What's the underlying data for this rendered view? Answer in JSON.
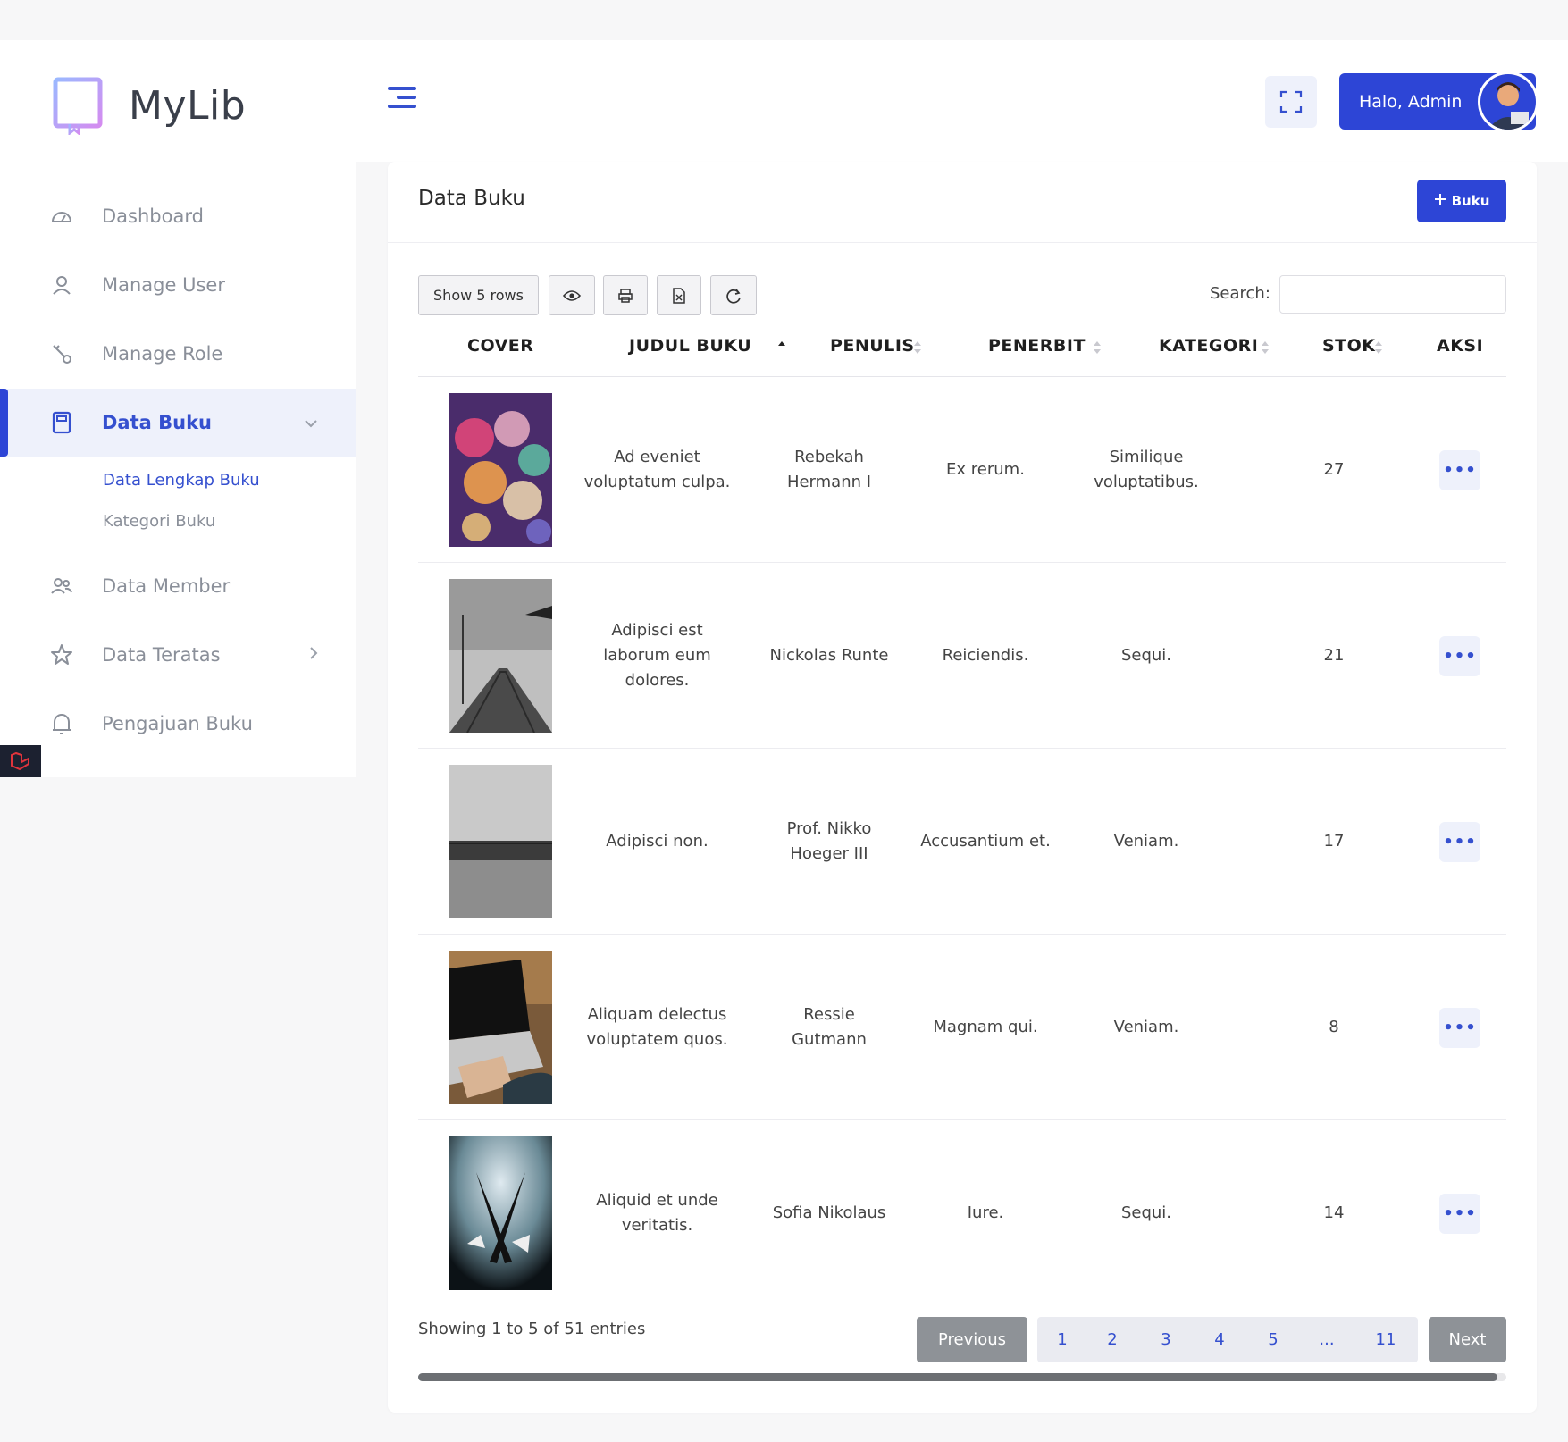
{
  "brand": {
    "name": "MyLib"
  },
  "sidebar": {
    "items": [
      {
        "label": "Dashboard",
        "icon": "dashboard-icon"
      },
      {
        "label": "Manage User",
        "icon": "user-icon"
      },
      {
        "label": "Manage Role",
        "icon": "key-icon"
      },
      {
        "label": "Data Buku",
        "icon": "book-icon",
        "active": true
      },
      {
        "label": "Data Member",
        "icon": "users-icon"
      },
      {
        "label": "Data Teratas",
        "icon": "star-icon"
      },
      {
        "label": "Pengajuan Buku",
        "icon": "bell-icon"
      }
    ],
    "subitems": [
      {
        "label": "Data Lengkap Buku",
        "active": true
      },
      {
        "label": "Kategori Buku",
        "active": false
      }
    ]
  },
  "topbar": {
    "user_label": "Halo, Admin"
  },
  "card": {
    "title": "Data Buku",
    "add_label": "Buku",
    "show_rows_label": "Show 5 rows",
    "search_label": "Search:",
    "search_value": ""
  },
  "table": {
    "headers": [
      "COVER",
      "JUDUL BUKU",
      "PENULIS",
      "PENERBIT",
      "KATEGORI",
      "STOK",
      "AKSI"
    ],
    "rows": [
      {
        "judul": "Ad eveniet voluptatum culpa.",
        "penulis": "Rebekah Hermann I",
        "penerbit": "Ex rerum.",
        "kategori": "Similique voluptatibus.",
        "stok": "27"
      },
      {
        "judul": "Adipisci est laborum eum dolores.",
        "penulis": "Nickolas Runte",
        "penerbit": "Reiciendis.",
        "kategori": "Sequi.",
        "stok": "21"
      },
      {
        "judul": "Adipisci non.",
        "penulis": "Prof. Nikko Hoeger III",
        "penerbit": "Accusantium et.",
        "kategori": "Veniam.",
        "stok": "17"
      },
      {
        "judul": "Aliquam delectus voluptatem quos.",
        "penulis": "Ressie Gutmann",
        "penerbit": "Magnam qui.",
        "kategori": "Veniam.",
        "stok": "8"
      },
      {
        "judul": "Aliquid et unde veritatis.",
        "penulis": "Sofia Nikolaus",
        "penerbit": "Iure.",
        "kategori": "Sequi.",
        "stok": "14"
      }
    ]
  },
  "pagination": {
    "info": "Showing 1 to 5 of 51 entries",
    "prev": "Previous",
    "next": "Next",
    "pages": [
      "1",
      "2",
      "3",
      "4",
      "5",
      "...",
      "11"
    ]
  },
  "colors": {
    "primary": "#2d45d6",
    "accent_bg": "#eef1fb",
    "muted_text": "#8a8f99"
  }
}
